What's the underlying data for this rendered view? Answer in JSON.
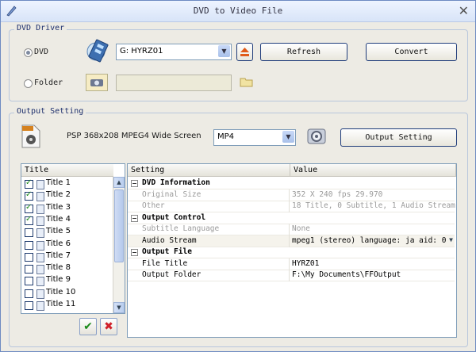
{
  "window": {
    "title": "DVD to Video File"
  },
  "dvd_driver": {
    "legend": "DVD Driver",
    "dvd_label": "DVD",
    "folder_label": "Folder",
    "drive_value": "G: HYRZ01",
    "folder_value": "",
    "refresh_label": "Refresh",
    "convert_label": "Convert",
    "selected_source": "DVD"
  },
  "output_setting": {
    "legend": "Output Setting",
    "profile_name": "PSP 368x208 MPEG4 Wide Screen",
    "format_value": "MP4",
    "output_setting_label": "Output Setting"
  },
  "titles": {
    "header": "Title",
    "items": [
      {
        "label": "Title 1",
        "checked": true
      },
      {
        "label": "Title 2",
        "checked": true
      },
      {
        "label": "Title 3",
        "checked": true
      },
      {
        "label": "Title 4",
        "checked": true
      },
      {
        "label": "Title 5",
        "checked": false
      },
      {
        "label": "Title 6",
        "checked": false
      },
      {
        "label": "Title 7",
        "checked": false
      },
      {
        "label": "Title 8",
        "checked": false
      },
      {
        "label": "Title 9",
        "checked": false
      },
      {
        "label": "Title 10",
        "checked": false
      },
      {
        "label": "Title 11",
        "checked": false
      }
    ]
  },
  "settings_grid": {
    "col_setting": "Setting",
    "col_value": "Value",
    "rows": [
      {
        "type": "category",
        "setting": "DVD Information",
        "value": ""
      },
      {
        "type": "readonly",
        "setting": "Original Size",
        "value": "352 X 240 fps 29.970"
      },
      {
        "type": "readonly",
        "setting": "Other",
        "value": "18 Title, 0 Subtitle, 1 Audio Stream"
      },
      {
        "type": "category",
        "setting": "Output Control",
        "value": ""
      },
      {
        "type": "readonly",
        "setting": "Subtitle Language",
        "value": "None"
      },
      {
        "type": "dropdown",
        "setting": "Audio Stream",
        "value": "mpeg1 (stereo) language: ja aid: 0"
      },
      {
        "type": "category",
        "setting": "Output File",
        "value": ""
      },
      {
        "type": "editable",
        "setting": "File Title",
        "value": "HYRZ01"
      },
      {
        "type": "editable",
        "setting": "Output Folder",
        "value": "F:\\My Documents\\FFOutput"
      }
    ]
  }
}
